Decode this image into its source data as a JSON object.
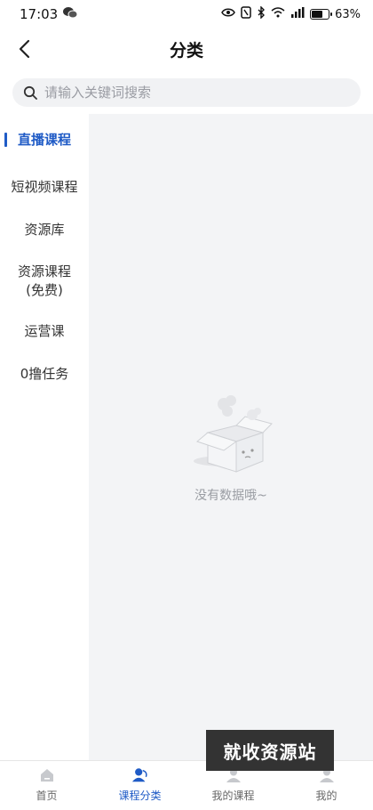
{
  "status": {
    "time": "17:03",
    "battery": "63%"
  },
  "header": {
    "title": "分类"
  },
  "search": {
    "placeholder": "请输入关键词搜索"
  },
  "sidebar": {
    "items": [
      {
        "label": "直播课程",
        "active": true
      },
      {
        "label": "短视频课程"
      },
      {
        "label": "资源库"
      },
      {
        "label": "资源课程",
        "label2": "(免费)"
      },
      {
        "label": "运营课"
      },
      {
        "label": "0撸任务"
      }
    ]
  },
  "empty": {
    "text": "没有数据哦~"
  },
  "tabbar": {
    "items": [
      {
        "label": "首页"
      },
      {
        "label": "课程分类",
        "active": true
      },
      {
        "label": "我的课程"
      },
      {
        "label": "我的"
      }
    ]
  },
  "watermark": {
    "text": "就收资源站"
  },
  "colors": {
    "accent": "#1f5bc6",
    "background": "#f3f4f6"
  }
}
